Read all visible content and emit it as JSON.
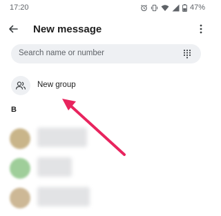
{
  "status_bar": {
    "time": "17:20",
    "battery": "47%",
    "icons": [
      "alarm-icon",
      "vibrate-icon",
      "wifi-icon",
      "signal-icon",
      "battery-icon"
    ]
  },
  "app_bar": {
    "title": "New message",
    "back_icon": "arrow-left-icon",
    "menu_icon": "more-vert-icon"
  },
  "search": {
    "placeholder": "Search name or number",
    "dialpad_icon": "dialpad-icon"
  },
  "new_group": {
    "label": "New group",
    "icon": "group-icon"
  },
  "contacts": {
    "section_letter": "B",
    "items": [
      {
        "blurred": true,
        "avatar_color": "#c9b58a"
      },
      {
        "blurred": true,
        "avatar_color": "#9fce9a"
      },
      {
        "blurred": true,
        "avatar_color": "#cdb896"
      }
    ]
  },
  "annotation": {
    "arrow_color": "#e8245e"
  }
}
